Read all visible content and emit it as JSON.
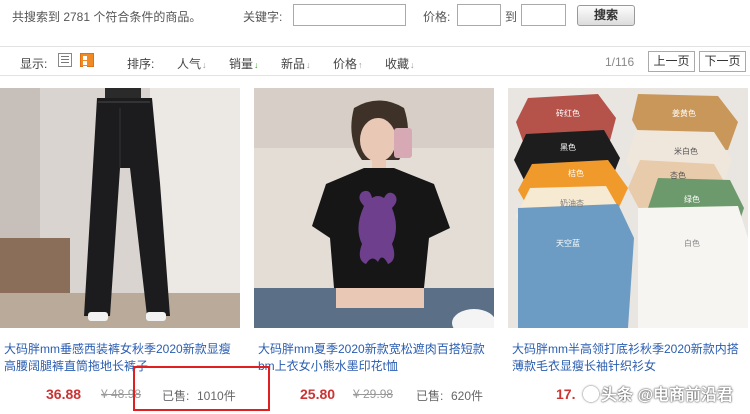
{
  "search": {
    "summary": "共搜索到 2781 个符合条件的商品。",
    "keyword_label": "关键字:",
    "keyword_value": "",
    "price_label": "价格:",
    "price_min": "",
    "price_max": "",
    "to_label": "到",
    "search_button": "搜索"
  },
  "toolbar": {
    "display_label": "显示:",
    "view_icons": [
      "list-view-icon",
      "grid-view-icon"
    ],
    "sort_label": "排序:",
    "sort_items": [
      {
        "label": "人气",
        "arrow": "↓",
        "active": false
      },
      {
        "label": "销量",
        "arrow": "↓",
        "active": true
      },
      {
        "label": "新品",
        "arrow": "↓",
        "active": false
      },
      {
        "label": "价格",
        "arrow": "↑",
        "active": false
      },
      {
        "label": "收藏",
        "arrow": "↓",
        "active": false
      }
    ],
    "page_count": "1/116",
    "prev_page": "上一页",
    "next_page": "下一页"
  },
  "products": [
    {
      "title": "大码胖mm垂感西装裤女秋季2020新款显瘦高腰阔腿裤直筒拖地长裤子",
      "price": "36.88",
      "old_price": "¥ 48.98",
      "sold_label": "已售:",
      "sold_count": "1010件"
    },
    {
      "title": "大码胖mm夏季2020新款宽松遮肉百搭短款bm上衣女小熊水墨印花t恤",
      "price": "25.80",
      "old_price": "¥ 29.98",
      "sold_label": "已售:",
      "sold_count": "620件"
    },
    {
      "title": "大码胖mm半高领打底衫秋季2020新款内搭薄款毛衣显瘦长袖针织衫女",
      "price": "17.",
      "old_price": "",
      "sold_label": "",
      "sold_count": ""
    }
  ],
  "shirt_labels": [
    "砖红色",
    "姜黄色",
    "黑色",
    "米白色",
    "桔色",
    "杏色",
    "奶油杏",
    "绿色",
    "天空蓝",
    "白色"
  ],
  "watermark": "头条 @电商前沿君",
  "colors": {
    "accent_orange": "#f08a24",
    "price_red": "#cc3333",
    "link_blue": "#2a5db0",
    "highlight_red": "#e02020",
    "sort_active_green": "#3cab2a"
  }
}
